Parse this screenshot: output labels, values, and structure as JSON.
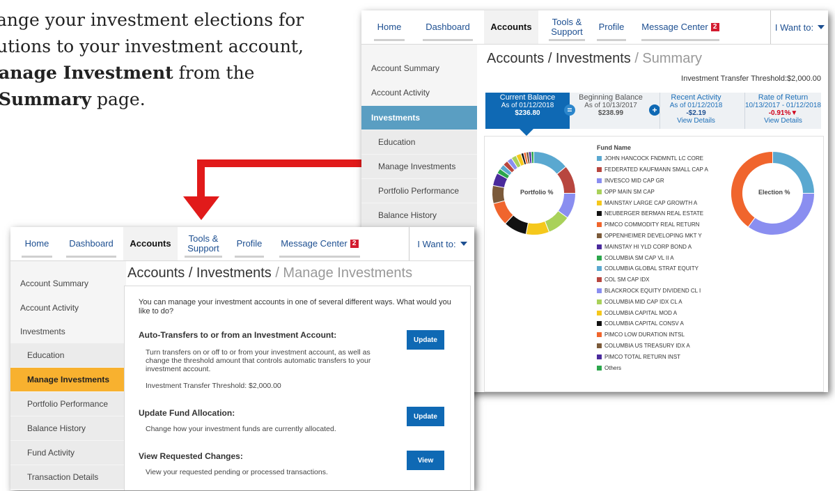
{
  "instructions": {
    "line1": "ange your investment elections for",
    "line2": "utions to your investment account,",
    "line3_bold": "anage Investment",
    "line3_rest": " from the",
    "line4_bold": "Summary",
    "line4_rest": " page."
  },
  "summary_screen": {
    "nav": {
      "home": "Home",
      "dashboard": "Dashboard",
      "accounts": "Accounts",
      "tools_line1": "Tools &",
      "tools_line2": "Support",
      "profile": "Profile",
      "message_center": "Message Center",
      "message_count": "2",
      "i_want_to": "I Want to:"
    },
    "sidebar": {
      "account_summary": "Account Summary",
      "account_activity": "Account Activity",
      "investments": "Investments",
      "education": "Education",
      "manage_investments": "Manage Investments",
      "portfolio_performance": "Portfolio Performance",
      "balance_history": "Balance History"
    },
    "title_main": "Accounts / Investments",
    "title_sub": " / Summary",
    "threshold": "Investment Transfer Threshold:$2,000.00",
    "tiles": {
      "current_label": "Current Balance",
      "current_date": "As of 01/12/2018",
      "current_value": "$236.80",
      "equals": "=",
      "beginning_label": "Beginning Balance",
      "beginning_date": "As of 10/13/2017",
      "beginning_value": "$238.99",
      "plus": "+",
      "recent_label": "Recent Activity",
      "recent_date": "As of 01/12/2018",
      "recent_value": "-$2.19",
      "recent_link": "View Details",
      "ror_label": "Rate of Return",
      "ror_range": "10/13/2017 - 01/12/2018",
      "ror_value": "-0.91%",
      "ror_arrow": "▼",
      "ror_link": "View Details"
    },
    "portfolio_label": "Portfolio %",
    "election_label": "Election %",
    "legend_title": "Fund Name",
    "funds": [
      {
        "name": "JOHN HANCOCK FNDMNTL LC CORE",
        "color": "#5aa8d0"
      },
      {
        "name": "FEDERATED KAUFMANN SMALL CAP A",
        "color": "#b8463f"
      },
      {
        "name": "INVESCO MID CAP GR",
        "color": "#8a8ef0"
      },
      {
        "name": "OPP MAIN SM CAP",
        "color": "#a9d15a"
      },
      {
        "name": "MAINSTAY LARGE CAP GROWTH A",
        "color": "#f5c81c"
      },
      {
        "name": "NEUBERGER BERMAN REAL ESTATE",
        "color": "#111111"
      },
      {
        "name": "PIMCO COMMODITY REAL RETURN",
        "color": "#f0652d"
      },
      {
        "name": "OPPENHEIMER DEVELOPING MKT Y",
        "color": "#7b5a3a"
      },
      {
        "name": "MAINSTAY HI YLD CORP BOND A",
        "color": "#4a2a9c"
      },
      {
        "name": "COLUMBIA SM CAP VL II A",
        "color": "#2ca64c"
      },
      {
        "name": "COLUMBIA GLOBAL STRAT EQUITY",
        "color": "#5aa8d0"
      },
      {
        "name": "COL SM CAP IDX",
        "color": "#b8463f"
      },
      {
        "name": "BLACKROCK EQUITY DIVIDEND CL I",
        "color": "#8a8ef0"
      },
      {
        "name": "COLUMBIA MID CAP IDX CL A",
        "color": "#a9d15a"
      },
      {
        "name": "COLUMBIA CAPITAL MOD A",
        "color": "#f5c81c"
      },
      {
        "name": "COLUMBIA CAPITAL CONSV A",
        "color": "#111111"
      },
      {
        "name": "PIMCO LOW DURATION INTSL",
        "color": "#f0652d"
      },
      {
        "name": "COLUMBIA US TREASURY IDX A",
        "color": "#7b5a3a"
      },
      {
        "name": "PIMCO TOTAL RETURN INST",
        "color": "#4a2a9c"
      },
      {
        "name": "Others",
        "color": "#2ca64c"
      }
    ]
  },
  "chart_data": [
    {
      "type": "pie",
      "title": "Portfolio %",
      "labels": [
        "JOHN HANCOCK FNDMNTL LC CORE",
        "FEDERATED KAUFMANN SMALL CAP A",
        "INVESCO MID CAP GR",
        "OPP MAIN SM CAP",
        "MAINSTAY LARGE CAP GROWTH A",
        "NEUBERGER BERMAN REAL ESTATE",
        "PIMCO COMMODITY REAL RETURN",
        "OPPENHEIMER DEVELOPING MKT Y",
        "MAINSTAY HI YLD CORP BOND A",
        "COLUMBIA SM CAP VL II A",
        "COLUMBIA GLOBAL STRAT EQUITY",
        "COL SM CAP IDX",
        "BLACKROCK EQUITY DIVIDEND CL I",
        "COLUMBIA MID CAP IDX CL A",
        "COLUMBIA CAPITAL MOD A",
        "COLUMBIA CAPITAL CONSV A",
        "PIMCO LOW DURATION INTSL",
        "COLUMBIA US TREASURY IDX A",
        "PIMCO TOTAL RETURN INST",
        "Others"
      ],
      "values": [
        14,
        11,
        10,
        9,
        9,
        9,
        9,
        7,
        5,
        2,
        2,
        2,
        2,
        2,
        2,
        1,
        1,
        1,
        1,
        1
      ],
      "colors": [
        "#5aa8d0",
        "#b8463f",
        "#8a8ef0",
        "#a9d15a",
        "#f5c81c",
        "#111111",
        "#f0652d",
        "#7b5a3a",
        "#4a2a9c",
        "#2ca64c",
        "#5aa8d0",
        "#b8463f",
        "#8a8ef0",
        "#a9d15a",
        "#f5c81c",
        "#111111",
        "#f0652d",
        "#7b5a3a",
        "#4a2a9c",
        "#2ca64c"
      ]
    },
    {
      "type": "pie",
      "title": "Election %",
      "labels": [
        "JOHN HANCOCK FNDMNTL LC CORE",
        "INVESCO MID CAP GR",
        "PIMCO COMMODITY REAL RETURN"
      ],
      "values": [
        25,
        35,
        40
      ],
      "colors": [
        "#5aa8d0",
        "#8a8ef0",
        "#f0652d"
      ]
    }
  ],
  "manage_screen": {
    "nav": {
      "home": "Home",
      "dashboard": "Dashboard",
      "accounts": "Accounts",
      "tools_line1": "Tools &",
      "tools_line2": "Support",
      "profile": "Profile",
      "message_center": "Message Center",
      "message_count": "2",
      "i_want_to": "I Want to:"
    },
    "sidebar": {
      "account_summary": "Account Summary",
      "account_activity": "Account Activity",
      "investments": "Investments",
      "education": "Education",
      "manage_investments": "Manage Investments",
      "portfolio_performance": "Portfolio Performance",
      "balance_history": "Balance History",
      "fund_activity": "Fund Activity",
      "transaction_details": "Transaction Details"
    },
    "title_main": "Accounts / Investments",
    "title_sub": " / Manage Investments",
    "intro": "You can manage your investment accounts in one of several different ways. What would you like to do?",
    "auto_transfers": {
      "title": "Auto-Transfers to or from an Investment Account:",
      "body": "Turn transfers on or off to or from your investment account, as well as change the threshold amount that controls automatic transfers to your investment account.",
      "threshold": "Investment Transfer Threshold: $2,000.00",
      "button": "Update"
    },
    "fund_allocation": {
      "title": "Update Fund Allocation:",
      "body": "Change how your investment funds are currently allocated.",
      "button": "Update"
    },
    "requested_changes": {
      "title": "View Requested Changes:",
      "body": "View your requested pending or processed transactions.",
      "button": "View"
    }
  }
}
